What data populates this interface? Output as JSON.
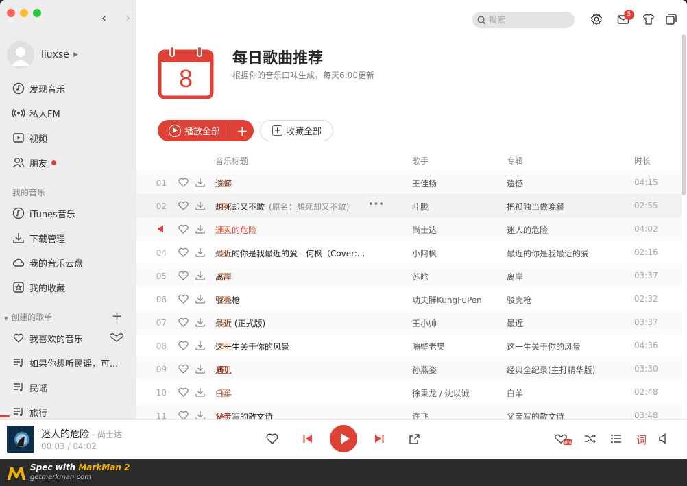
{
  "user": {
    "name": "liuxse"
  },
  "search": {
    "placeholder": "搜索"
  },
  "notif": {
    "count": "5"
  },
  "sidebar": {
    "nav": [
      {
        "label": "发现音乐",
        "icon": "music-note-icon"
      },
      {
        "label": "私人FM",
        "icon": "radio-icon"
      },
      {
        "label": "视频",
        "icon": "video-icon"
      },
      {
        "label": "朋友",
        "icon": "friends-icon"
      }
    ],
    "my_music_header": "我的音乐",
    "my_music": [
      {
        "label": "iTunes音乐",
        "icon": "itunes-icon"
      },
      {
        "label": "下载管理",
        "icon": "download-icon"
      },
      {
        "label": "我的音乐云盘",
        "icon": "cloud-icon"
      },
      {
        "label": "我的收藏",
        "icon": "star-icon"
      }
    ],
    "playlists_header": "创建的歌单",
    "playlists": [
      {
        "label": "我喜欢的音乐",
        "icon": "heart-icon"
      },
      {
        "label": "如果你想听民谣，可...",
        "icon": "playlist-icon"
      },
      {
        "label": "民谣",
        "icon": "playlist-icon"
      },
      {
        "label": "旅行",
        "icon": "playlist-icon"
      }
    ]
  },
  "header": {
    "day": "8",
    "title": "每日歌曲推荐",
    "subtitle": "根据你的音乐口味生成，每天6:00更新",
    "play_all": "播放全部",
    "collect_all": "收藏全部"
  },
  "table": {
    "columns": {
      "title": "音乐标题",
      "singer": "歌手",
      "album": "专辑",
      "duration": "时长"
    },
    "rows": [
      {
        "num": "01",
        "title": "遗憾",
        "extra": "",
        "sq": true,
        "mv": false,
        "singer": "王佳杨",
        "album": "遗憾",
        "duration": "04:15"
      },
      {
        "num": "02",
        "title": "想死却又不敢",
        "extra": "(原名：想死却又不敢)",
        "sq": true,
        "mv": false,
        "singer": "叶胧",
        "album": "把孤独当做晚餐",
        "duration": "02:55"
      },
      {
        "num": "",
        "title": "迷人的危险",
        "extra": "",
        "sq": true,
        "mv": false,
        "singer": "尚士达",
        "album": "迷人的危险",
        "duration": "04:02"
      },
      {
        "num": "04",
        "title": "最近的你是我最近的爱 - 何枫（Cover:...",
        "extra": "",
        "sq": true,
        "mv": false,
        "singer": "小阿枫",
        "album": "最近的你是我最近的爱",
        "duration": "02:16"
      },
      {
        "num": "05",
        "title": "离岸",
        "extra": "",
        "sq": true,
        "mv": false,
        "singer": "苏晗",
        "album": "离岸",
        "duration": "03:37"
      },
      {
        "num": "06",
        "title": "驳壳枪",
        "extra": "",
        "sq": true,
        "mv": false,
        "singer": "功夫胖KungFuPen",
        "album": "驳壳枪",
        "duration": "02:32"
      },
      {
        "num": "07",
        "title": "最近 (正式版)",
        "extra": "",
        "sq": true,
        "mv": false,
        "singer": "王小帅",
        "album": "最近",
        "duration": "03:37"
      },
      {
        "num": "08",
        "title": "这一生关于你的风景",
        "extra": "",
        "sq": true,
        "mv": false,
        "singer": "隔壁老樊",
        "album": "这一生关于你的风景",
        "duration": "04:36"
      },
      {
        "num": "09",
        "title": "遇见",
        "extra": "",
        "sq": true,
        "mv": true,
        "singer": "孙燕姿",
        "album": "经典全纪录(主打精华版)",
        "duration": "03:30"
      },
      {
        "num": "10",
        "title": "白羊",
        "extra": "",
        "sq": true,
        "mv": false,
        "singer": "徐秉龙 / 沈以诚",
        "album": "白羊",
        "duration": "02:48"
      },
      {
        "num": "11",
        "title": "父亲写的散文诗",
        "extra": "",
        "sq": true,
        "mv": true,
        "singer": "许飞",
        "album": "父亲写的散文诗",
        "duration": "03:48"
      }
    ]
  },
  "player": {
    "title": "迷人的危险",
    "artist": "尚士达",
    "current": "00:03",
    "total": "04:02",
    "lyric_btn": "词"
  },
  "watermark": {
    "line1_a": "Spec with ",
    "line1_b": "MarkMan 2",
    "line2": "getmarkman.com"
  },
  "colors": {
    "accent": "#df4137",
    "text": "#252525",
    "subtext": "#7d7d7d"
  }
}
